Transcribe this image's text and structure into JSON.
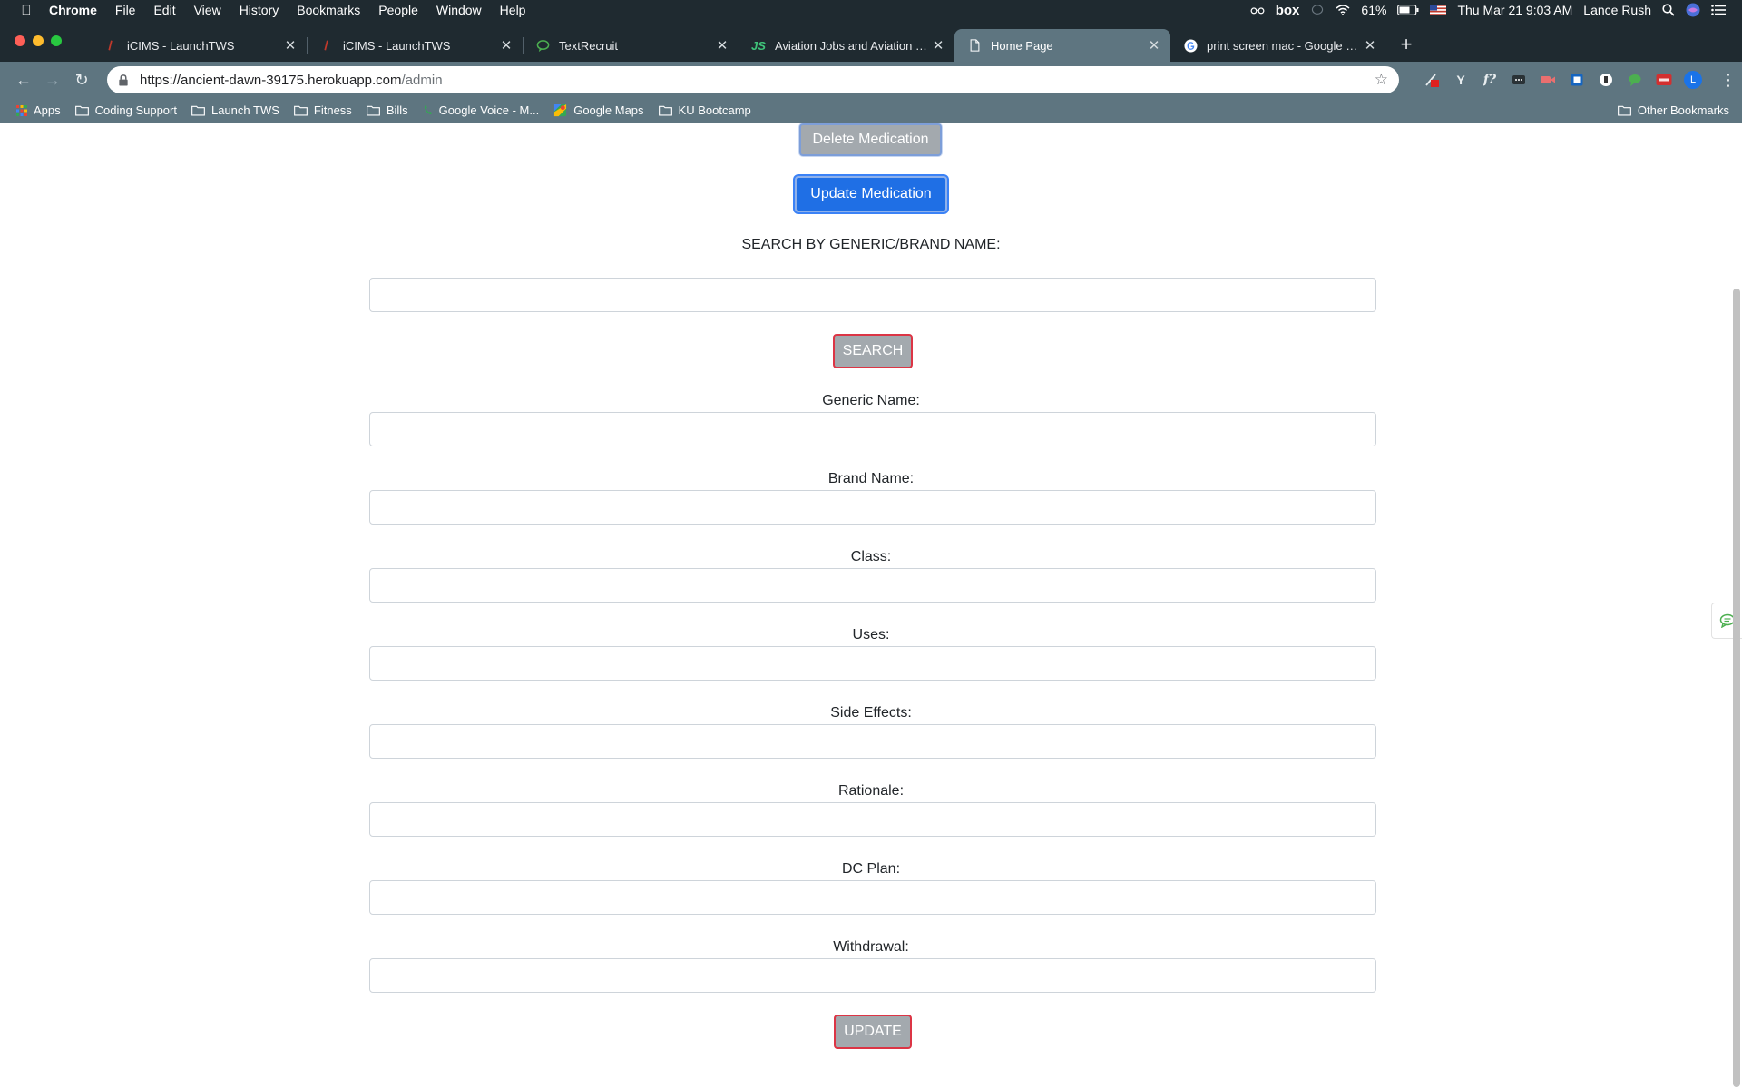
{
  "menubar": {
    "app": "Chrome",
    "items": [
      "File",
      "Edit",
      "View",
      "History",
      "Bookmarks",
      "People",
      "Window",
      "Help"
    ],
    "box_label": "box",
    "battery": "61%",
    "datetime": "Thu Mar 21  9:03 AM",
    "user": "Lance Rush"
  },
  "tabs": [
    {
      "title": "iCIMS - LaunchTWS",
      "icon": "icims-icon",
      "active": false
    },
    {
      "title": "iCIMS - LaunchTWS",
      "icon": "icims-icon",
      "active": false
    },
    {
      "title": "TextRecruit",
      "icon": "chat-bubble-icon",
      "active": false
    },
    {
      "title": "Aviation Jobs and Aviation Emp",
      "icon": "jobsite-icon",
      "active": false
    },
    {
      "title": "Home Page",
      "icon": "document-icon",
      "active": true
    },
    {
      "title": "print screen mac - Google Sear",
      "icon": "google-icon",
      "active": false
    }
  ],
  "toolbar": {
    "url_host": "https://ancient-dawn-39175.herokuapp.com",
    "url_path": "/admin",
    "profile_initial": "L",
    "ext_y": "Y",
    "ext_f": "f?"
  },
  "bookmarks": {
    "apps": "Apps",
    "items": [
      "Coding Support",
      "Launch TWS",
      "Fitness",
      "Bills",
      "Google Voice - M...",
      "Google Maps",
      "KU Bootcamp"
    ],
    "other": "Other Bookmarks"
  },
  "page": {
    "delete_button": "Delete Medication",
    "update_medication_button": "Update Medication",
    "search_label": "SEARCH BY GENERIC/BRAND NAME:",
    "search_button": "SEARCH",
    "fields": {
      "generic": "Generic Name:",
      "brand": "Brand Name:",
      "class": "Class:",
      "uses": "Uses:",
      "side_effects": "Side Effects:",
      "rationale": "Rationale:",
      "dc_plan": "DC Plan:",
      "withdrawal": "Withdrawal:"
    },
    "update_button": "UPDATE"
  }
}
